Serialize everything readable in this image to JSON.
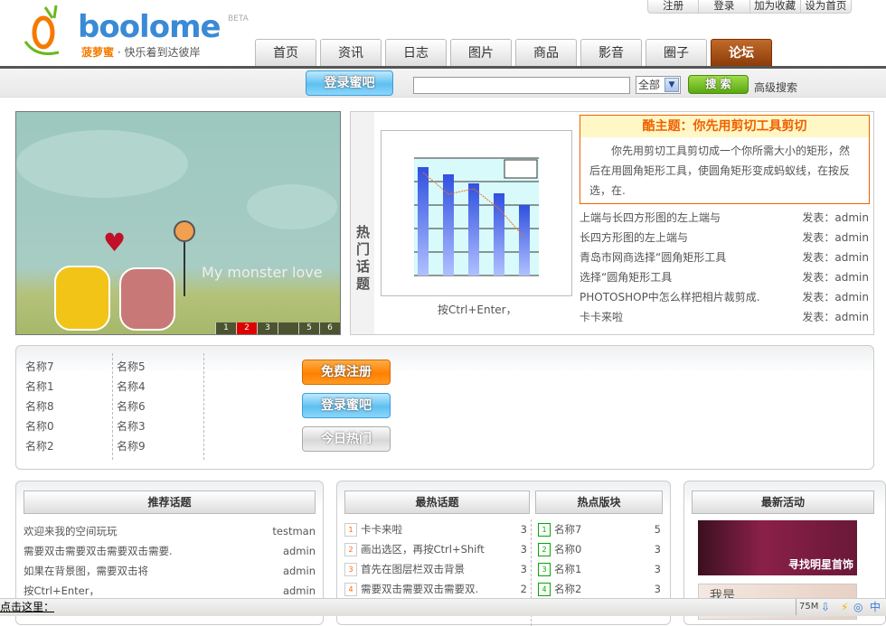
{
  "toplinks": [
    "注册",
    "登录",
    "加为收藏",
    "设为首页"
  ],
  "logo": {
    "name": "boolome",
    "beta": "BETA",
    "brand": "菠萝蜜",
    "slogan": "· 快乐着到达彼岸"
  },
  "nav": [
    "首页",
    "资讯",
    "日志",
    "图片",
    "商品",
    "影音",
    "圈子",
    "论坛"
  ],
  "search": {
    "login_button": "登录蜜吧",
    "query": "",
    "scope": "全部",
    "search_button": "搜 索",
    "advanced": "高级搜索"
  },
  "hero": {
    "text": "My monster love",
    "pages": [
      "1",
      "2",
      "3",
      "",
      "5",
      "6"
    ],
    "active_page": 2
  },
  "hot": {
    "label": "热门话题",
    "caption": "按Ctrl+Enter，",
    "feature": {
      "title": "酷主题：你先用剪切工具剪切",
      "body": "你先用剪切工具剪切成一个你所需大小的矩形，然后在用圆角矩形工具，使圆角矩形变成蚂蚁线，在按反选，在."
    },
    "items": [
      {
        "title": "上端与长四方形图的左上端与",
        "author": "发表：admin"
      },
      {
        "title": "长四方形图的左上端与",
        "author": "发表：admin"
      },
      {
        "title": "青岛市网商选择“圆角矩形工具",
        "author": "发表：admin"
      },
      {
        "title": "选择“圆角矩形工具",
        "author": "发表：admin"
      },
      {
        "title": "PHOTOSHOP中怎么样把相片裁剪成.",
        "author": "发表：admin"
      },
      {
        "title": "卡卡来啦",
        "author": "发表：admin"
      }
    ]
  },
  "members": {
    "col1": [
      "名称7",
      "名称1",
      "名称8",
      "名称0",
      "名称2"
    ],
    "col2": [
      "名称5",
      "名称4",
      "名称6",
      "名称3",
      "名称9"
    ],
    "register": "免费注册",
    "login": "登录蜜吧",
    "today": "今日热门"
  },
  "recommend": {
    "title": "推荐话题",
    "items": [
      {
        "t": "欢迎来我的空间玩玩",
        "a": "testman"
      },
      {
        "t": "需要双击需要双击需要双击需要.",
        "a": "admin"
      },
      {
        "t": "如果在背景图，需要双击将",
        "a": "admin"
      },
      {
        "t": "按Ctrl+Enter，",
        "a": "admin"
      }
    ]
  },
  "hottest": {
    "title": "最热话题",
    "items": [
      {
        "n": "1",
        "t": "卡卡来啦",
        "c": "3"
      },
      {
        "n": "2",
        "t": "画出选区，再按Ctrl+Shift",
        "c": "3"
      },
      {
        "n": "3",
        "t": "首先在图层栏双击背景",
        "c": "3"
      },
      {
        "n": "4",
        "t": "需要双击需要双击需要双.",
        "c": "2"
      }
    ]
  },
  "boards": {
    "title": "热点版块",
    "items": [
      {
        "n": "1",
        "t": "名称7",
        "c": "5"
      },
      {
        "n": "2",
        "t": "名称0",
        "c": "3"
      },
      {
        "n": "3",
        "t": "名称1",
        "c": "3"
      },
      {
        "n": "4",
        "t": "名称2",
        "c": "3"
      }
    ]
  },
  "events": {
    "title": "最新活动",
    "ad1": "寻找明星首饰",
    "ad2": "我是"
  },
  "status": {
    "text": "点击这里：",
    "mem": "75M"
  },
  "colors": {
    "accent": "#f06000",
    "nav_active": "#8a3a08",
    "link_blue": "#3a8ad6"
  }
}
